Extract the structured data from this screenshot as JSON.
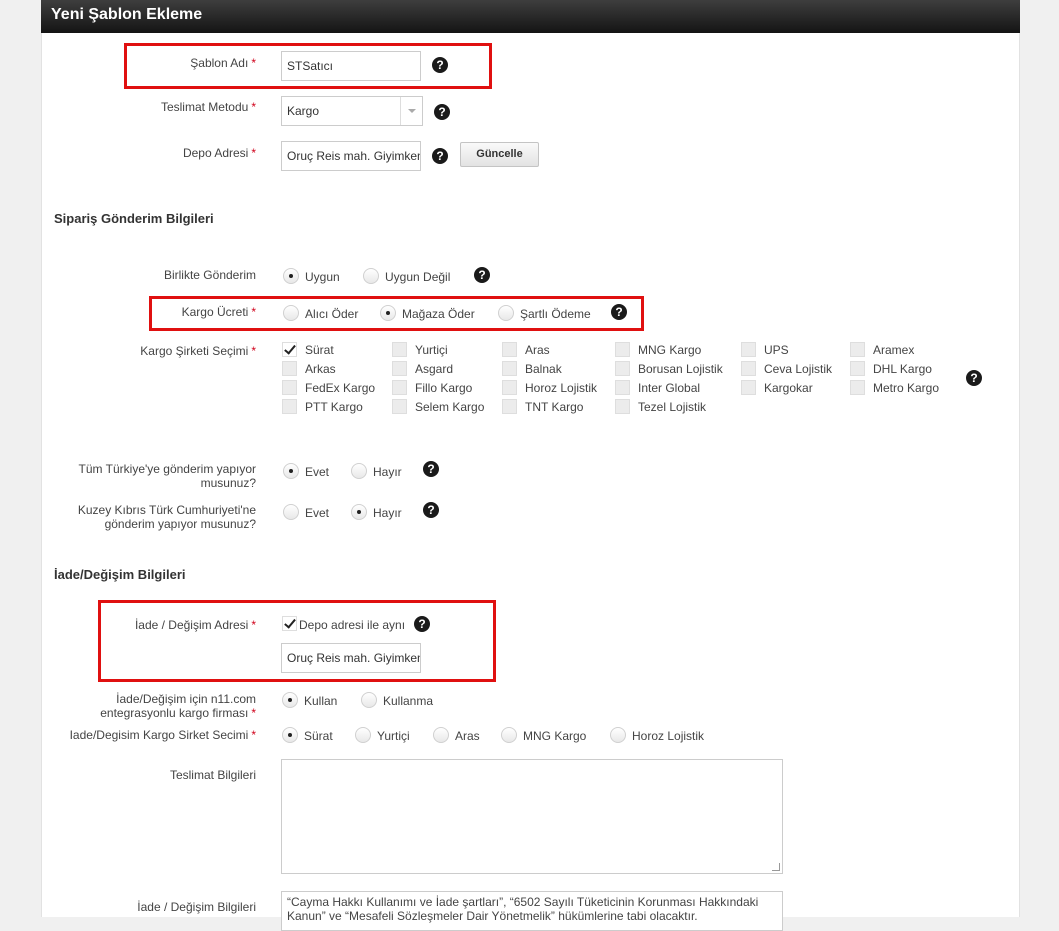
{
  "page_title": "Yeni Şablon Ekleme",
  "template_name": {
    "label": "Şablon Adı",
    "value": "STSatıcı"
  },
  "delivery_method": {
    "label": "Teslimat Metodu",
    "value": "Kargo"
  },
  "warehouse_address": {
    "label": "Depo Adresi",
    "value": "Oruç Reis mah. Giyimkent",
    "update_button": "Güncelle"
  },
  "shipping_section": {
    "title": "Sipariş Gönderim Bilgileri"
  },
  "combined_shipping": {
    "label": "Birlikte Gönderim",
    "options": [
      "Uygun",
      "Uygun Değil"
    ],
    "selected": "Uygun"
  },
  "shipping_fee": {
    "label": "Kargo Ücreti",
    "options": [
      "Alıcı Öder",
      "Mağaza Öder",
      "Şartlı Ödeme"
    ],
    "selected": "Mağaza Öder"
  },
  "carrier_selection": {
    "label": "Kargo Şirketi Seçimi",
    "rows": [
      [
        "Sürat",
        "Yurtiçi",
        "Aras",
        "MNG Kargo",
        "UPS",
        "Aramex"
      ],
      [
        "Arkas",
        "Asgard",
        "Balnak",
        "Borusan Lojistik",
        "Ceva Lojistik",
        "DHL Kargo"
      ],
      [
        "FedEx Kargo",
        "Fillo Kargo",
        "Horoz Lojistik",
        "Inter Global",
        "Kargokar",
        "Metro Kargo"
      ],
      [
        "PTT Kargo",
        "Selem Kargo",
        "TNT Kargo",
        "Tezel Lojistik"
      ]
    ],
    "checked": [
      "Sürat"
    ]
  },
  "all_turkey": {
    "label_line1": "Tüm Türkiye'ye gönderim yapıyor",
    "label_line2": "musunuz?",
    "options": [
      "Evet",
      "Hayır"
    ],
    "selected": "Evet"
  },
  "kktc": {
    "label_line1": "Kuzey Kıbrıs Türk Cumhuriyeti'ne",
    "label_line2": "gönderim yapıyor musunuz?",
    "options": [
      "Evet",
      "Hayır"
    ],
    "selected": "Hayır"
  },
  "return_section": {
    "title": "İade/Değişim Bilgileri"
  },
  "return_address": {
    "label": "İade / Değişim Adresi",
    "same_as_warehouse": "Depo adresi ile aynı",
    "same_checked": true,
    "value": "Oruç Reis mah. Giyimkent"
  },
  "return_integrated": {
    "label_line1": "İade/Değişim için n11.com",
    "label_line2": "entegrasyonlu kargo firması",
    "options": [
      "Kullan",
      "Kullanma"
    ],
    "selected": "Kullan"
  },
  "return_carrier": {
    "label": "Iade/Degisim Kargo Sirket Secimi",
    "options": [
      "Sürat",
      "Yurtiçi",
      "Aras",
      "MNG Kargo",
      "Horoz Lojistik"
    ],
    "selected": "Sürat"
  },
  "delivery_info": {
    "label": "Teslimat Bilgileri",
    "value": ""
  },
  "return_info": {
    "label": "İade / Değişim Bilgileri",
    "value": "“Cayma Hakkı Kullanımı ve İade şartları”, “6502 Sayılı Tüketicinin Korunması Hakkındaki Kanun” ve “Mesafeli Sözleşmeler Dair Yönetmelik” hükümlerine tabi olacaktır."
  },
  "colors": {
    "header_bg": "#1c1c1c",
    "required": "#d0021b",
    "highlight_box": "#e01010"
  },
  "icons": {
    "help": "question-circle-icon",
    "check": "checkmark-icon"
  }
}
